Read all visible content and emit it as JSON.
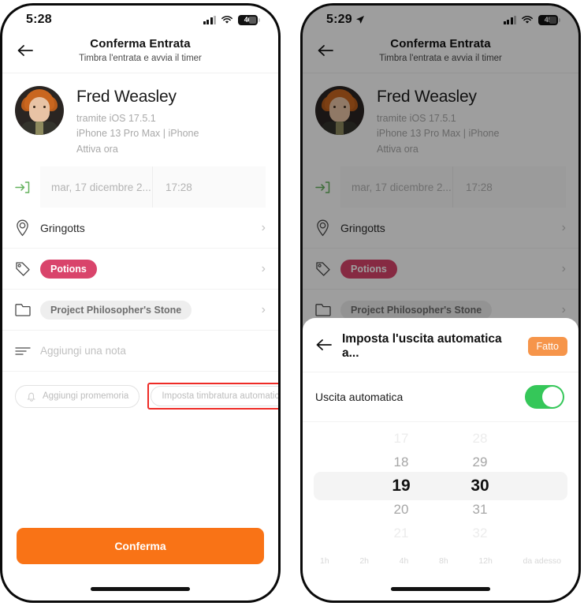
{
  "theme": {
    "accent_orange": "#f97316",
    "done_orange": "#f6954a",
    "badge_pink": "#d9446b",
    "toggle_green": "#35c759",
    "highlight_red": "#ee2b26",
    "checkin_green": "#63b15c"
  },
  "left_phone": {
    "status_bar": {
      "time": "5:28",
      "battery": "46",
      "signal_icon": "cellular-bars-icon",
      "wifi_icon": "wifi-icon",
      "battery_icon": "battery-icon"
    },
    "nav": {
      "back_icon": "back-arrow-icon",
      "title": "Conferma Entrata",
      "subtitle": "Timbra l'entrata e avvia il timer"
    },
    "user": {
      "avatar_icon": "user-avatar",
      "name": "Fred Weasley",
      "meta_line1": "tramite iOS 17.5.1",
      "meta_line2": "iPhone 13 Pro Max | iPhone",
      "meta_line3": "Attiva ora"
    },
    "datetime_row": {
      "icon": "check-in-arrow-icon",
      "date_value": "mar, 17 dicembre 2...",
      "time_value": "17:28"
    },
    "rows": [
      {
        "icon": "location-pin-icon",
        "label": "Gringotts",
        "style": "plain",
        "chevron": "›"
      },
      {
        "icon": "tag-icon",
        "label": "Potions",
        "style": "badge",
        "chevron": "›"
      },
      {
        "icon": "folder-icon",
        "label": "Project Philosopher's Stone",
        "style": "chip",
        "chevron": "›"
      }
    ],
    "note_row": {
      "icon": "note-lines-icon",
      "placeholder": "Aggiungi una nota"
    },
    "pills": [
      {
        "icon": "bell-icon",
        "label": "Aggiungi promemoria",
        "highlighted": false
      },
      {
        "icon": "",
        "label": "Imposta timbratura automatica",
        "highlighted": true
      }
    ],
    "cta_label": "Conferma"
  },
  "right_phone": {
    "status_bar": {
      "time": "5:29",
      "location_icon": "location-arrow-icon",
      "battery": "45",
      "signal_icon": "cellular-bars-icon",
      "wifi_icon": "wifi-icon",
      "battery_icon": "battery-icon"
    },
    "nav": {
      "back_icon": "back-arrow-icon",
      "title": "Conferma Entrata",
      "subtitle": "Timbra l'entrata e avvia il timer"
    },
    "user": {
      "avatar_icon": "user-avatar",
      "name": "Fred Weasley",
      "meta_line1": "tramite iOS 17.5.1",
      "meta_line2": "iPhone 13 Pro Max | iPhone",
      "meta_line3": "Attiva ora"
    },
    "datetime_row": {
      "icon": "check-in-arrow-icon",
      "date_value": "mar, 17 dicembre 2...",
      "time_value": "17:28"
    },
    "rows": [
      {
        "icon": "location-pin-icon",
        "label": "Gringotts",
        "style": "plain",
        "chevron": "›"
      },
      {
        "icon": "tag-icon",
        "label": "Potions",
        "style": "badge",
        "chevron": "›"
      },
      {
        "icon": "folder-icon",
        "label": "Project Philosopher's Stone",
        "style": "chip",
        "chevron": "›"
      }
    ],
    "sheet": {
      "back_icon": "back-arrow-icon",
      "title": "Imposta l'uscita automatica a...",
      "done_label": "Fatto",
      "toggle_label": "Uscita automatica",
      "toggle_on": true,
      "picker": {
        "hours": {
          "far_above": "17",
          "above": "18",
          "selected": "19",
          "below": "20",
          "far_below": "21"
        },
        "minutes": {
          "far_above": "28",
          "above": "29",
          "selected": "30",
          "below": "31",
          "far_below": "32"
        }
      },
      "quick_options": [
        "1h",
        "2h",
        "4h",
        "8h",
        "12h",
        "da adesso"
      ]
    }
  }
}
